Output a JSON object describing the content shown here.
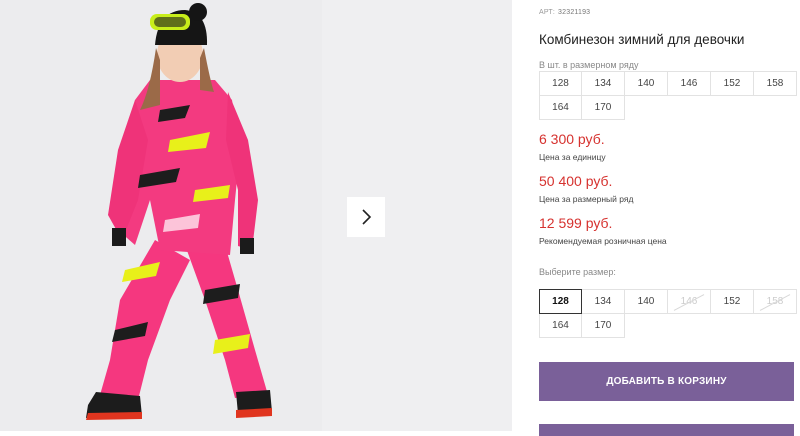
{
  "product": {
    "article_label": "АРТ:",
    "article_value": "32321193",
    "title": "Комбинезон зимний для девочки"
  },
  "size_range": {
    "label": "В шт. в размерном ряду",
    "sizes": [
      "128",
      "134",
      "140",
      "146",
      "152",
      "158",
      "164",
      "170"
    ]
  },
  "prices": {
    "unit_price": "6 300 руб.",
    "unit_caption": "Цена за единицу",
    "range_price": "50 400 руб.",
    "range_caption": "Цена за размерный ряд",
    "retail_price": "12 599 руб.",
    "retail_caption": "Рекомендуемая розничная цена"
  },
  "size_select": {
    "label": "Выберите размер:",
    "options": [
      {
        "value": "128",
        "state": "selected"
      },
      {
        "value": "134",
        "state": "available"
      },
      {
        "value": "140",
        "state": "available"
      },
      {
        "value": "146",
        "state": "unavailable"
      },
      {
        "value": "152",
        "state": "available"
      },
      {
        "value": "158",
        "state": "unavailable"
      },
      {
        "value": "164",
        "state": "available"
      },
      {
        "value": "170",
        "state": "available"
      }
    ]
  },
  "actions": {
    "add_to_cart": "ДОБАВИТЬ В КОРЗИНУ"
  },
  "colors": {
    "price": "#d6322f",
    "button": "#7a6099",
    "photo_bg": "#ececee"
  },
  "icons": {
    "next": "chevron-right-icon"
  }
}
